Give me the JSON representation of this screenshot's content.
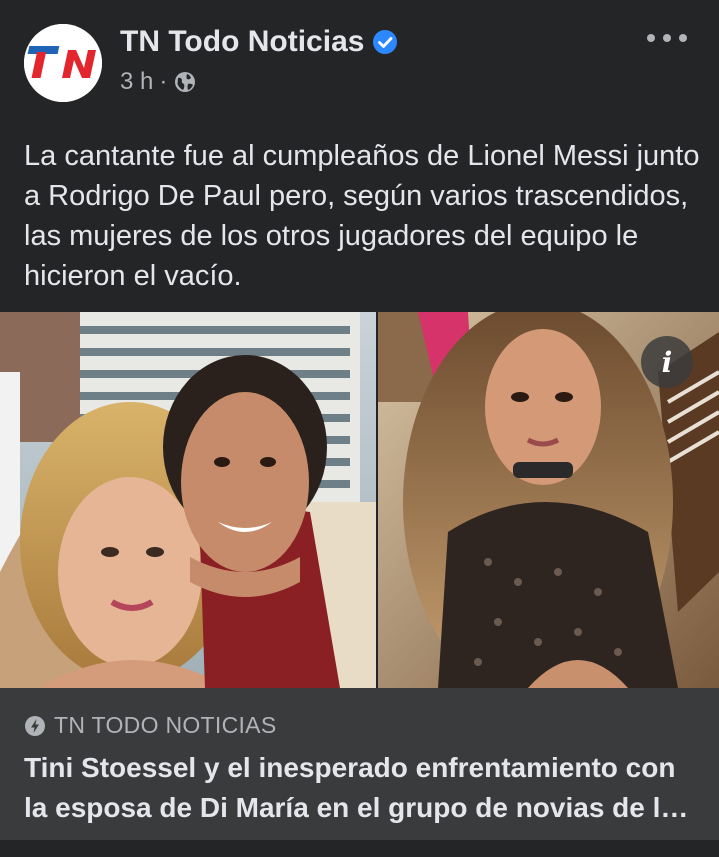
{
  "post": {
    "page_name": "TN Todo Noticias",
    "time": "3 h",
    "separator": "·",
    "avatar_text": "TN",
    "text": "La cantante fue al cumpleaños de Lionel Messi junto a Rodrigo De Paul pero, según varios trascendidos, las mujeres de los otros jugadores del equipo le hicieron el vacío."
  },
  "icons": {
    "verified": "verified-badge-icon",
    "globe": "globe-icon",
    "more": "more-options-icon",
    "info": "info-icon",
    "bolt": "instant-article-bolt-icon"
  },
  "info_glyph": "i",
  "link": {
    "domain": "TN TODO NOTICIAS",
    "title_line1": "Tini Stoessel y el inesperado enfrentamiento con",
    "title_line2": "la esposa de Di María en el grupo de novias de l…"
  },
  "colors": {
    "background": "#242526",
    "card": "#3a3b3c",
    "primary_text": "#e4e6eb",
    "secondary_text": "#b0b3b8",
    "verified_blue": "#2d88ff",
    "tn_red": "#e3262e",
    "tn_blue": "#1f64b5"
  }
}
